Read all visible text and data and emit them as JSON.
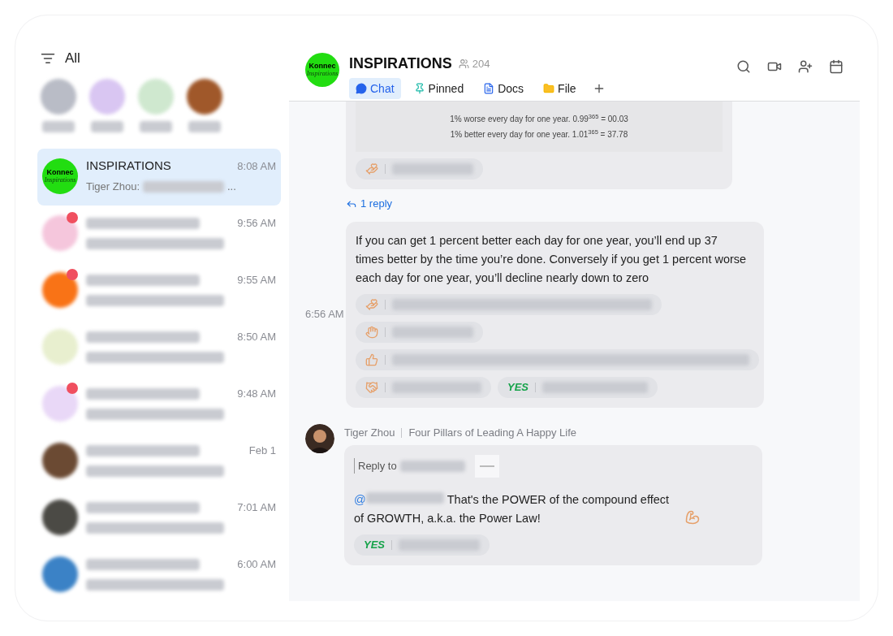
{
  "sidebar": {
    "title": "All",
    "favorites": [
      {
        "color": "#b9bcc6"
      },
      {
        "color": "#d9c6f2"
      },
      {
        "color": "#cfe8cf"
      },
      {
        "color": "#a0582a"
      }
    ],
    "chats": [
      {
        "name": "INSPIRATIONS",
        "preview": "Tiger Zhou:",
        "preview_end": "...",
        "time": "8:08 AM",
        "selected": true,
        "color": "#22dd11",
        "unread": false,
        "logo_lines": [
          "Konnec",
          "Inspirations"
        ]
      },
      {
        "time": "9:56 AM",
        "selected": false,
        "color": "#f5c6dc",
        "unread": true
      },
      {
        "time": "9:55 AM",
        "selected": false,
        "color": "#f97316",
        "unread": true
      },
      {
        "time": "8:50 AM",
        "selected": false,
        "color": "#e8efcf",
        "unread": false
      },
      {
        "time": "9:48 AM",
        "selected": false,
        "color": "#e9d8f7",
        "unread": true
      },
      {
        "time": "Feb 1",
        "selected": false,
        "color": "#6b4a33",
        "unread": false
      },
      {
        "time": "7:01 AM",
        "selected": false,
        "color": "#4b4a45",
        "unread": false
      },
      {
        "time": "6:00 AM",
        "selected": false,
        "color": "#3b82c6",
        "unread": false
      }
    ]
  },
  "chat": {
    "logo_lines": [
      "Konnec",
      "Inspirations"
    ],
    "title": "INSPIRATIONS",
    "members": "204",
    "tabs": [
      {
        "label": "Chat",
        "kind": "chat",
        "selected": true
      },
      {
        "label": "Pinned",
        "kind": "pin",
        "selected": false
      },
      {
        "label": "Docs",
        "kind": "docs",
        "selected": false
      },
      {
        "label": "File",
        "kind": "file",
        "selected": false
      }
    ],
    "messages": [
      {
        "kind": "image",
        "image_lines": [
          "1% worse every day for one year. 0.99$^{365}$ = 00.03",
          "1% better every day for one year. 1.01$^{365}$ = 37.78"
        ],
        "reactions": [
          {
            "kind": "hearthands"
          }
        ],
        "reply_link": "1 reply"
      },
      {
        "kind": "text",
        "time": "6:56 AM",
        "text": "If you can get 1 percent better each day for one year, you’ll end up 37 times better by the time you’re done. Conversely if you get 1 percent worse each day for one year, you’ll decline nearly down to zero",
        "reactions": [
          {
            "kind": "hearthands"
          },
          {
            "kind": "pray"
          },
          {
            "kind": "thumbsup"
          },
          {
            "kind": "handshake"
          },
          {
            "kind": "yes",
            "label": "YES"
          }
        ]
      },
      {
        "kind": "reply",
        "sender": "Tiger Zhou",
        "topic": "Four Pillars of Leading A Happy Life",
        "reply_to": "Reply to",
        "mention": "@",
        "text": "That's the POWER of the compound effect of GROWTH, a.k.a. the Power Law!",
        "reactions": [
          {
            "kind": "yes",
            "label": "YES"
          }
        ]
      }
    ]
  }
}
